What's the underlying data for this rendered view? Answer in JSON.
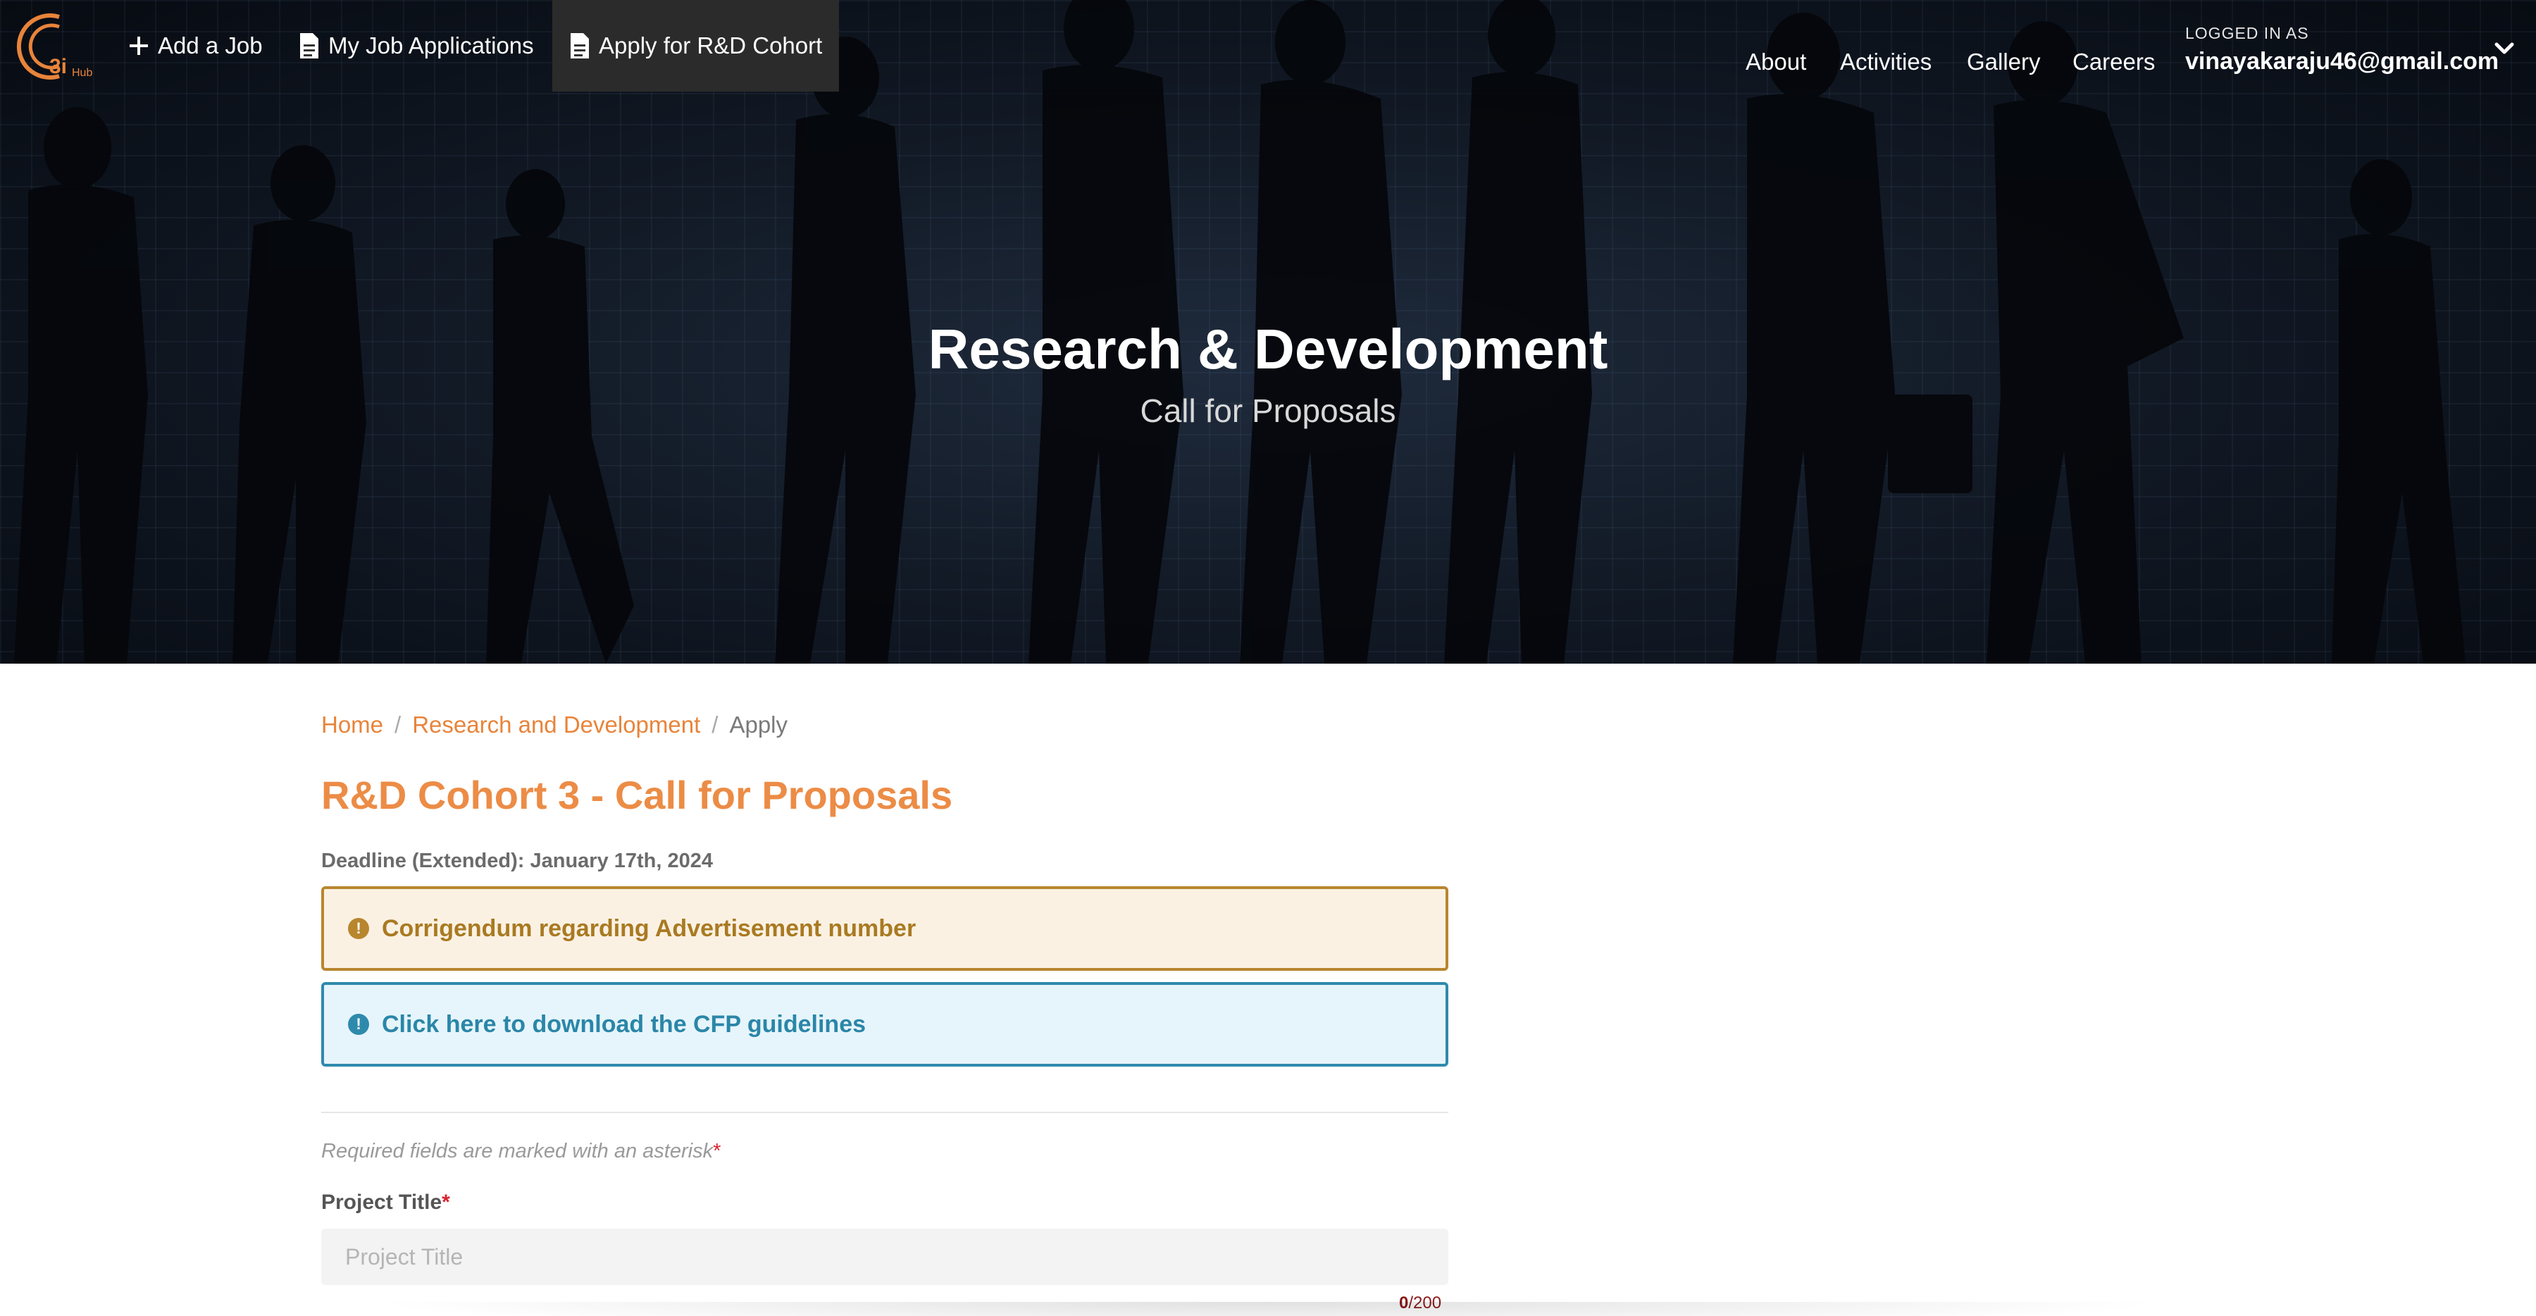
{
  "nav": {
    "logo_text": "3i",
    "logo_sub": "Hub",
    "add_job": "Add a Job",
    "my_applications": "My Job Applications",
    "apply_cohort": "Apply for R&D Cohort",
    "links": [
      "About",
      "Activities",
      "Gallery",
      "Careers"
    ],
    "logged_in_label": "LOGGED IN AS",
    "user_email": "vinayakaraju46@gmail.com"
  },
  "hero": {
    "title": "Research & Development",
    "subtitle": "Call for Proposals"
  },
  "breadcrumb": {
    "home": "Home",
    "section": "Research and Development",
    "current": "Apply",
    "separator": "/"
  },
  "page": {
    "title": "R&D Cohort 3 - Call for Proposals",
    "deadline": "Deadline (Extended): January 17th, 2024"
  },
  "alerts": {
    "warning_text": "Corrigendum regarding Advertisement number",
    "info_text": "Click here to download the CFP guidelines",
    "icon_glyph": "!"
  },
  "form": {
    "required_note": "Required fields are marked with an asterisk",
    "asterisk": "*",
    "project_title_label": "Project Title",
    "project_title_placeholder": "Project Title",
    "project_title_value": "",
    "char_count": "0",
    "char_max": "/200"
  },
  "colors": {
    "accent": "#ec8c46",
    "warning_border": "#b8862e",
    "info_border": "#2e8aac",
    "required": "#d9232e"
  }
}
